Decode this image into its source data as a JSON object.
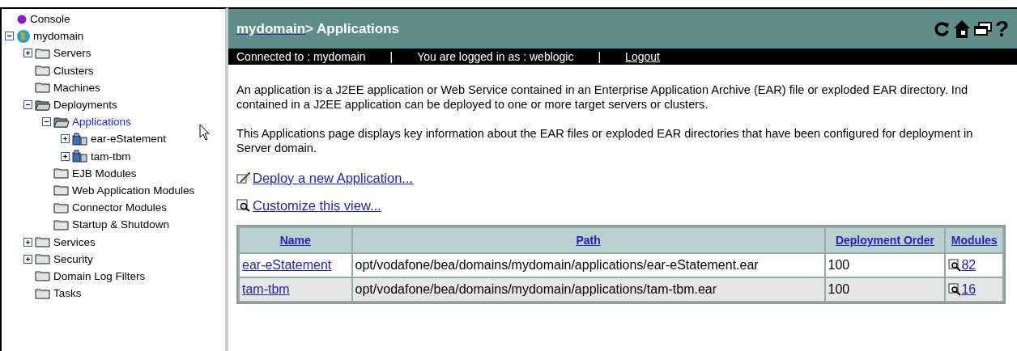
{
  "tree": [
    {
      "label": "Console",
      "kind": "console",
      "selected": false
    },
    {
      "label": "mydomain",
      "kind": "domain",
      "selected": false,
      "expanded": true,
      "children": [
        {
          "label": "Servers",
          "kind": "folder",
          "selected": false,
          "expanded": false
        },
        {
          "label": "Clusters",
          "kind": "folder",
          "selected": false
        },
        {
          "label": "Machines",
          "kind": "folder",
          "selected": false
        },
        {
          "label": "Deployments",
          "kind": "folder",
          "selected": false,
          "expanded": true,
          "children": [
            {
              "label": "Applications",
              "kind": "folder",
              "selected": true,
              "expanded": true,
              "children": [
                {
                  "label": "ear-eStatement",
                  "kind": "app",
                  "selected": false,
                  "expanded": false
                },
                {
                  "label": "tam-tbm",
                  "kind": "app",
                  "selected": false,
                  "expanded": false
                }
              ]
            },
            {
              "label": "EJB Modules",
              "kind": "folder",
              "selected": false
            },
            {
              "label": "Web Application Modules",
              "kind": "folder",
              "selected": false
            },
            {
              "label": "Connector Modules",
              "kind": "folder",
              "selected": false
            },
            {
              "label": "Startup & Shutdown",
              "kind": "folder",
              "selected": false
            }
          ]
        },
        {
          "label": "Services",
          "kind": "folder",
          "selected": false,
          "expanded": false
        },
        {
          "label": "Security",
          "kind": "folder",
          "selected": false,
          "expanded": false
        },
        {
          "label": "Domain Log Filters",
          "kind": "folder",
          "selected": false
        },
        {
          "label": "Tasks",
          "kind": "folder",
          "selected": false
        }
      ]
    }
  ],
  "header": {
    "breadcrumb_link": "mydomain",
    "title": "> Applications",
    "help_icon": "?"
  },
  "status_bar": {
    "connected": "Connected to :  mydomain",
    "separator_1": "|",
    "logged_in": "You are logged in as :  weblogic",
    "separator_2": "|",
    "logout": "Logout"
  },
  "paragraphs": [
    [
      "An application is a J2EE application or Web Service contained in an Enterprise Application Archive (EAR) file or exploded EAR directory. Ind",
      "contained in a J2EE application can be deployed to one or more target servers or clusters."
    ],
    [
      "This Applications page displays key information about the EAR files or exploded EAR directories that have been configured for deployment in",
      "Server domain."
    ]
  ],
  "actions": [
    {
      "label": "Deploy a new Application...",
      "kind": "deploy"
    },
    {
      "label": "Customize this view...",
      "kind": "customize"
    }
  ],
  "table": {
    "columns": [
      "Name",
      "Path",
      "Deployment Order",
      "Modules"
    ],
    "rows": [
      {
        "name": "ear-eStatement",
        "path": "opt/vodafone/bea/domains/mydomain/applications/ear-eStatement.ear",
        "order": "100",
        "modules": "82"
      },
      {
        "name": "tam-tbm",
        "path": "opt/vodafone/bea/domains/mydomain/applications/tam-tbm.ear",
        "order": "100",
        "modules": "16"
      }
    ]
  }
}
